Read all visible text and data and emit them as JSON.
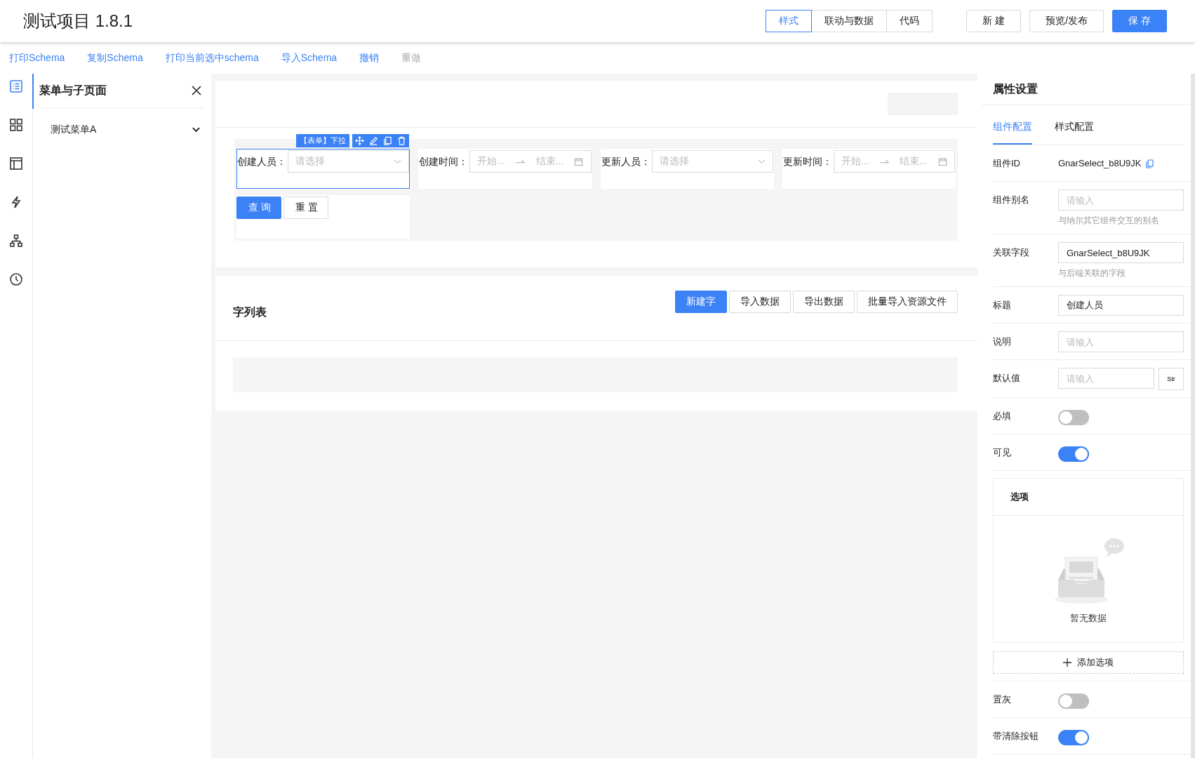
{
  "header": {
    "title": "测试项目 1.8.1",
    "view_tabs": [
      {
        "label": "样式",
        "selected": true
      },
      {
        "label": "联动与数据",
        "selected": false
      },
      {
        "label": "代码",
        "selected": false
      }
    ],
    "actions": [
      {
        "label": "新 建",
        "kind": "default"
      },
      {
        "label": "预览/发布",
        "kind": "default"
      },
      {
        "label": "保 存",
        "kind": "primary"
      }
    ]
  },
  "toolbar": [
    {
      "label": "打印Schema",
      "disabled": false
    },
    {
      "label": "复制Schema",
      "disabled": false
    },
    {
      "label": "打印当前选中schema",
      "disabled": false
    },
    {
      "label": "导入Schema",
      "disabled": false
    },
    {
      "label": "撤销",
      "disabled": false
    },
    {
      "label": "重做",
      "disabled": true
    }
  ],
  "rail": [
    {
      "kind": "list",
      "selected": true
    },
    {
      "kind": "grid",
      "selected": false
    },
    {
      "kind": "layout",
      "selected": false
    },
    {
      "kind": "bolt",
      "selected": false
    },
    {
      "kind": "tree",
      "selected": false
    },
    {
      "kind": "clock",
      "selected": false
    }
  ],
  "menu_panel": {
    "title": "菜单与子页面",
    "items": [
      {
        "label": "测试菜单A"
      }
    ]
  },
  "canvas": {
    "selection_tag": "【表单】下拉",
    "filters": [
      {
        "kind": "select",
        "label": "创建人员：",
        "placeholder": "请选择",
        "selected": true
      },
      {
        "kind": "range",
        "label": "创建时间：",
        "start": "开始...",
        "end": "结束...",
        "selected": false
      },
      {
        "kind": "select",
        "label": "更新人员：",
        "placeholder": "请选择",
        "selected": false
      },
      {
        "kind": "range",
        "label": "更新时间：",
        "start": "开始...",
        "end": "结束...",
        "selected": false
      }
    ],
    "form_buttons": [
      {
        "label": "查 询",
        "kind": "primary"
      },
      {
        "label": "重 置",
        "kind": "default"
      }
    ],
    "list_card": {
      "title": "字列表",
      "buttons": [
        {
          "label": "新建字",
          "kind": "primary"
        },
        {
          "label": "导入数据",
          "kind": "default"
        },
        {
          "label": "导出数据",
          "kind": "default"
        },
        {
          "label": "批量导入资源文件",
          "kind": "default"
        }
      ]
    }
  },
  "props": {
    "title": "属性设置",
    "tabs": [
      {
        "label": "组件配置",
        "selected": true
      },
      {
        "label": "样式配置",
        "selected": false
      }
    ],
    "rows": [
      {
        "kind": "text",
        "label": "组件ID",
        "value": "GnarSelect_b8U9JK"
      },
      {
        "kind": "input",
        "label": "组件别名",
        "placeholder": "请输入",
        "hint": "与纳尔其它组件交互的别名"
      },
      {
        "kind": "input",
        "label": "关联字段",
        "value": "GnarSelect_b8U9JK",
        "hint": "与后端关联的字段"
      },
      {
        "kind": "input",
        "label": "标题",
        "value": "创建人员"
      },
      {
        "kind": "input",
        "label": "说明",
        "placeholder": "请输入"
      },
      {
        "kind": "input",
        "label": "默认值",
        "placeholder": "请输入",
        "addon": "Str"
      },
      {
        "kind": "toggle",
        "label": "必填",
        "on": false
      },
      {
        "kind": "toggle",
        "label": "可见",
        "on": true
      },
      {
        "kind": "options",
        "label": "选项",
        "empty_text": "暂无数据",
        "add_label": "添加选项"
      },
      {
        "kind": "toggle",
        "label": "置灰",
        "on": false
      },
      {
        "kind": "toggle",
        "label": "带清除按钮",
        "on": true
      }
    ]
  }
}
